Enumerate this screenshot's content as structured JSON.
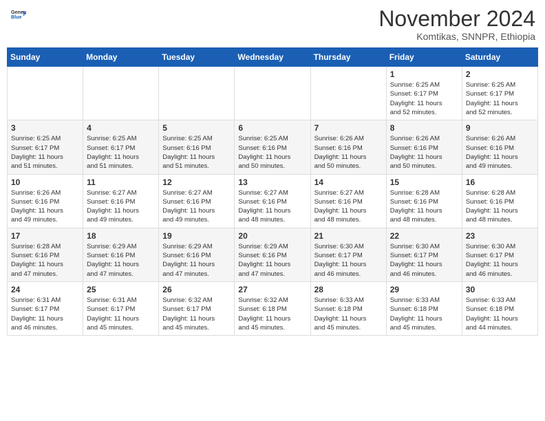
{
  "header": {
    "logo_general": "General",
    "logo_blue": "Blue",
    "month_title": "November 2024",
    "location": "Komtikas, SNNPR, Ethiopia"
  },
  "weekdays": [
    "Sunday",
    "Monday",
    "Tuesday",
    "Wednesday",
    "Thursday",
    "Friday",
    "Saturday"
  ],
  "weeks": [
    [
      {
        "day": "",
        "info": ""
      },
      {
        "day": "",
        "info": ""
      },
      {
        "day": "",
        "info": ""
      },
      {
        "day": "",
        "info": ""
      },
      {
        "day": "",
        "info": ""
      },
      {
        "day": "1",
        "info": "Sunrise: 6:25 AM\nSunset: 6:17 PM\nDaylight: 11 hours\nand 52 minutes."
      },
      {
        "day": "2",
        "info": "Sunrise: 6:25 AM\nSunset: 6:17 PM\nDaylight: 11 hours\nand 52 minutes."
      }
    ],
    [
      {
        "day": "3",
        "info": "Sunrise: 6:25 AM\nSunset: 6:17 PM\nDaylight: 11 hours\nand 51 minutes."
      },
      {
        "day": "4",
        "info": "Sunrise: 6:25 AM\nSunset: 6:17 PM\nDaylight: 11 hours\nand 51 minutes."
      },
      {
        "day": "5",
        "info": "Sunrise: 6:25 AM\nSunset: 6:16 PM\nDaylight: 11 hours\nand 51 minutes."
      },
      {
        "day": "6",
        "info": "Sunrise: 6:25 AM\nSunset: 6:16 PM\nDaylight: 11 hours\nand 50 minutes."
      },
      {
        "day": "7",
        "info": "Sunrise: 6:26 AM\nSunset: 6:16 PM\nDaylight: 11 hours\nand 50 minutes."
      },
      {
        "day": "8",
        "info": "Sunrise: 6:26 AM\nSunset: 6:16 PM\nDaylight: 11 hours\nand 50 minutes."
      },
      {
        "day": "9",
        "info": "Sunrise: 6:26 AM\nSunset: 6:16 PM\nDaylight: 11 hours\nand 49 minutes."
      }
    ],
    [
      {
        "day": "10",
        "info": "Sunrise: 6:26 AM\nSunset: 6:16 PM\nDaylight: 11 hours\nand 49 minutes."
      },
      {
        "day": "11",
        "info": "Sunrise: 6:27 AM\nSunset: 6:16 PM\nDaylight: 11 hours\nand 49 minutes."
      },
      {
        "day": "12",
        "info": "Sunrise: 6:27 AM\nSunset: 6:16 PM\nDaylight: 11 hours\nand 49 minutes."
      },
      {
        "day": "13",
        "info": "Sunrise: 6:27 AM\nSunset: 6:16 PM\nDaylight: 11 hours\nand 48 minutes."
      },
      {
        "day": "14",
        "info": "Sunrise: 6:27 AM\nSunset: 6:16 PM\nDaylight: 11 hours\nand 48 minutes."
      },
      {
        "day": "15",
        "info": "Sunrise: 6:28 AM\nSunset: 6:16 PM\nDaylight: 11 hours\nand 48 minutes."
      },
      {
        "day": "16",
        "info": "Sunrise: 6:28 AM\nSunset: 6:16 PM\nDaylight: 11 hours\nand 48 minutes."
      }
    ],
    [
      {
        "day": "17",
        "info": "Sunrise: 6:28 AM\nSunset: 6:16 PM\nDaylight: 11 hours\nand 47 minutes."
      },
      {
        "day": "18",
        "info": "Sunrise: 6:29 AM\nSunset: 6:16 PM\nDaylight: 11 hours\nand 47 minutes."
      },
      {
        "day": "19",
        "info": "Sunrise: 6:29 AM\nSunset: 6:16 PM\nDaylight: 11 hours\nand 47 minutes."
      },
      {
        "day": "20",
        "info": "Sunrise: 6:29 AM\nSunset: 6:16 PM\nDaylight: 11 hours\nand 47 minutes."
      },
      {
        "day": "21",
        "info": "Sunrise: 6:30 AM\nSunset: 6:17 PM\nDaylight: 11 hours\nand 46 minutes."
      },
      {
        "day": "22",
        "info": "Sunrise: 6:30 AM\nSunset: 6:17 PM\nDaylight: 11 hours\nand 46 minutes."
      },
      {
        "day": "23",
        "info": "Sunrise: 6:30 AM\nSunset: 6:17 PM\nDaylight: 11 hours\nand 46 minutes."
      }
    ],
    [
      {
        "day": "24",
        "info": "Sunrise: 6:31 AM\nSunset: 6:17 PM\nDaylight: 11 hours\nand 46 minutes."
      },
      {
        "day": "25",
        "info": "Sunrise: 6:31 AM\nSunset: 6:17 PM\nDaylight: 11 hours\nand 45 minutes."
      },
      {
        "day": "26",
        "info": "Sunrise: 6:32 AM\nSunset: 6:17 PM\nDaylight: 11 hours\nand 45 minutes."
      },
      {
        "day": "27",
        "info": "Sunrise: 6:32 AM\nSunset: 6:18 PM\nDaylight: 11 hours\nand 45 minutes."
      },
      {
        "day": "28",
        "info": "Sunrise: 6:33 AM\nSunset: 6:18 PM\nDaylight: 11 hours\nand 45 minutes."
      },
      {
        "day": "29",
        "info": "Sunrise: 6:33 AM\nSunset: 6:18 PM\nDaylight: 11 hours\nand 45 minutes."
      },
      {
        "day": "30",
        "info": "Sunrise: 6:33 AM\nSunset: 6:18 PM\nDaylight: 11 hours\nand 44 minutes."
      }
    ]
  ]
}
